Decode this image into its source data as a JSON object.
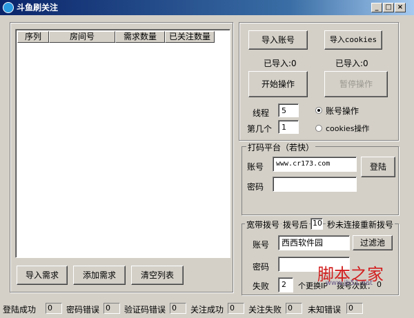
{
  "window": {
    "title": "斗鱼刷关注"
  },
  "list": {
    "columns": [
      "序列",
      "房间号",
      "需求数量",
      "已关注数量"
    ],
    "buttons": {
      "import": "导入需求",
      "add": "添加需求",
      "clear": "清空列表"
    }
  },
  "account": {
    "import_account_label": "导入账号",
    "import_cookies_label": "导入cookies",
    "imported_account_text": "已导入:0",
    "imported_cookies_text": "已导入:0",
    "start_label": "开始操作",
    "pause_label": "暂停操作",
    "thread_label": "线程",
    "thread_value": "5",
    "index_label": "第几个",
    "index_value": "1",
    "radio_account_label": "账号操作",
    "radio_cookies_label": "cookies操作"
  },
  "captcha": {
    "group_title": "打码平台（若快）",
    "account_label": "账号",
    "account_value": "www.cr173.com",
    "password_label": "密码",
    "password_value": "",
    "login_label": "登陆"
  },
  "broadband": {
    "group_title": "宽带拨号",
    "dial_prefix": "拨号后",
    "dial_seconds": "10",
    "dial_suffix": "秒未连接重新拨号",
    "account_label": "账号",
    "account_value": "西西软件园",
    "filter_label": "过滤池",
    "password_label": "密码",
    "password_value": "",
    "fail_label": "失败",
    "fail_value": "2",
    "fail_suffix": "个更换IP",
    "dial_count_label": "拨号次数：",
    "dial_count_value": "0"
  },
  "status": {
    "items": [
      {
        "label": "登陆成功",
        "value": "0"
      },
      {
        "label": "密码错误",
        "value": "0"
      },
      {
        "label": "验证码错误",
        "value": "0"
      },
      {
        "label": "关注成功",
        "value": "0"
      },
      {
        "label": "关注失败",
        "value": "0"
      },
      {
        "label": "未知错误",
        "value": "0"
      }
    ]
  },
  "watermark": {
    "text": "脚本之家",
    "url": "www.jb51.net"
  }
}
